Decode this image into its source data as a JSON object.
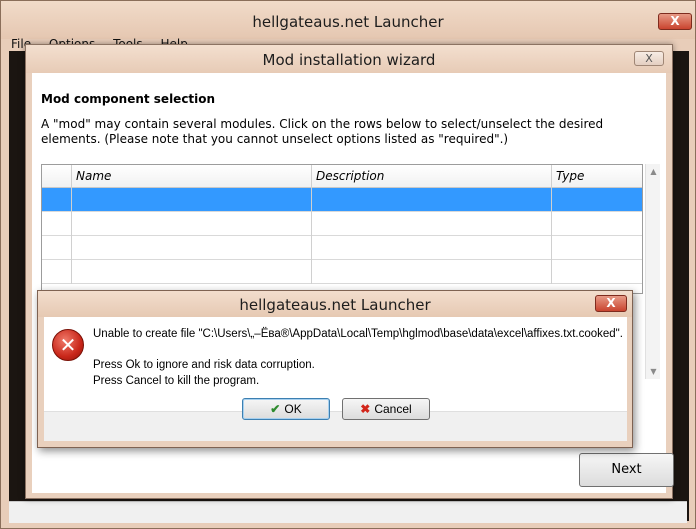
{
  "launcher": {
    "title": "hellgateaus.net Launcher",
    "close_label": "X",
    "menu": [
      "File",
      "Options",
      "Tools",
      "Help"
    ]
  },
  "wizard": {
    "title": "Mod installation wizard",
    "close_label": "X",
    "heading": "Mod component selection",
    "description": "A \"mod\" may contain several modules. Click on the rows below to select/unselect the desired elements. (Please note that you cannot unselect options listed as \"required\".)",
    "columns": [
      "Name",
      "Description",
      "Type"
    ],
    "rows": [
      {
        "name": "",
        "description": "",
        "type": "",
        "selected": true
      },
      {
        "name": "",
        "description": "",
        "type": "",
        "selected": false
      },
      {
        "name": "",
        "description": "",
        "type": "",
        "selected": false
      },
      {
        "name": "",
        "description": "",
        "type": "",
        "selected": false
      }
    ],
    "next_label": "Next"
  },
  "error_dialog": {
    "title": "hellgateaus.net Launcher",
    "close_label": "X",
    "message": "Unable to create file \"C:\\Users\\„–Ёва®\\AppData\\Local\\Temp\\hglmod\\base\\data\\excel\\affixes.txt.cooked\".",
    "line2": "Press Ok to ignore and risk data corruption.",
    "line3": "Press Cancel to kill the program.",
    "ok_label": "OK",
    "cancel_label": "Cancel"
  },
  "colors": {
    "selection": "#3399ff",
    "title_bar": "#e9d0bd",
    "close_red": "#c9442f"
  }
}
